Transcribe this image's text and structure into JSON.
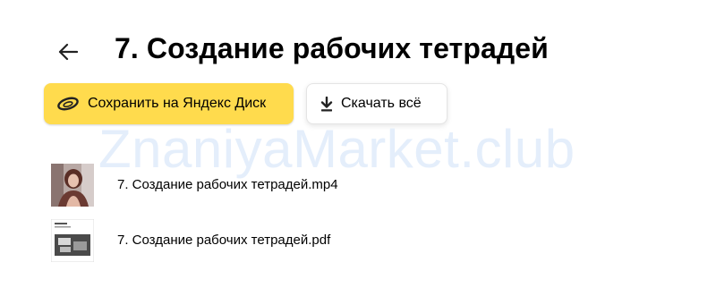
{
  "header": {
    "back_icon": "arrow-left-icon",
    "title": "7. Создание рабочих тетрадей"
  },
  "actions": {
    "save": {
      "label": "Сохранить на Яндекс Диск",
      "icon": "yandex-disk-icon",
      "color": "#ffdb4d"
    },
    "download": {
      "label": "Скачать всё",
      "icon": "download-icon"
    }
  },
  "watermark": "ZnaniyaMarket.club",
  "files": [
    {
      "name": "7. Создание рабочих тетрадей.mp4",
      "type": "video",
      "icon": "video-thumbnail"
    },
    {
      "name": "7. Создание рабочих тетрадей.pdf",
      "type": "pdf",
      "icon": "pdf-thumbnail"
    }
  ]
}
